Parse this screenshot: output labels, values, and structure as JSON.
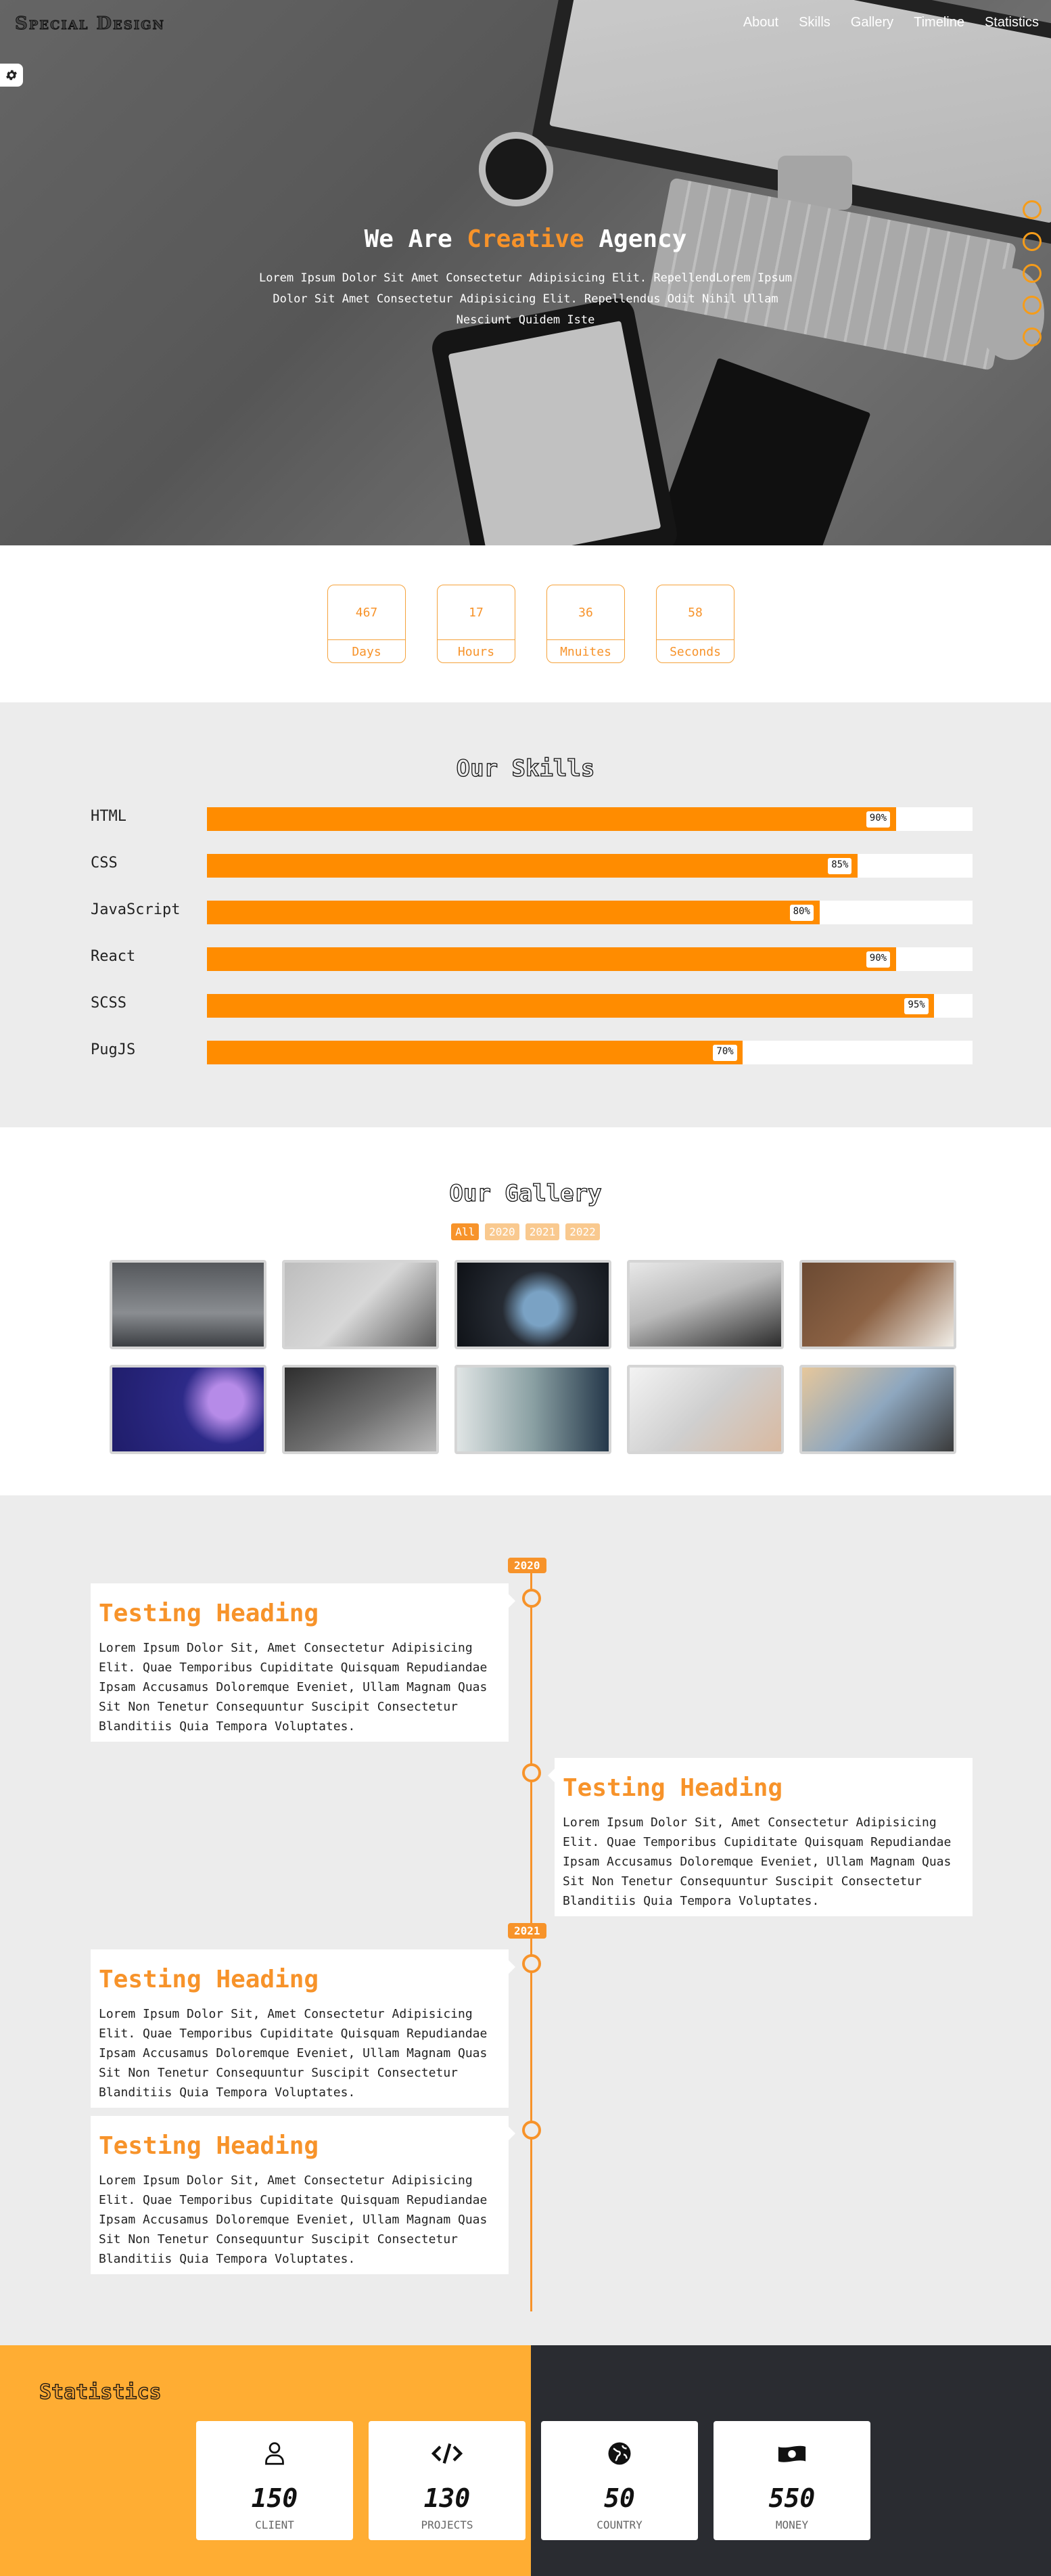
{
  "header": {
    "logo": "Special Design",
    "nav": [
      "About",
      "Skills",
      "Gallery",
      "Timeline",
      "Statistics"
    ]
  },
  "hero": {
    "title_prefix": "We Are ",
    "title_accent": "Creative",
    "title_suffix": " Agency",
    "text": "Lorem Ipsum Dolor Sit Amet Consectetur Adipisicing Elit. RepellendLorem Ipsum Dolor Sit Amet Consectetur Adipisicing Elit. Repellendus Odit Nihil Ullam Nesciunt Quidem Iste",
    "accent_color": "#f7932a"
  },
  "countdown": [
    {
      "value": "467",
      "unit": "Days"
    },
    {
      "value": "17",
      "unit": "Hours"
    },
    {
      "value": "36",
      "unit": "Mnuites"
    },
    {
      "value": "58",
      "unit": "Seconds"
    }
  ],
  "skills": {
    "title": "Our Skills",
    "items": [
      {
        "name": "HTML",
        "percent": 90,
        "label": "90%"
      },
      {
        "name": "CSS",
        "percent": 85,
        "label": "85%"
      },
      {
        "name": "JavaScript",
        "percent": 80,
        "label": "80%"
      },
      {
        "name": "React",
        "percent": 90,
        "label": "90%"
      },
      {
        "name": "SCSS",
        "percent": 95,
        "label": "95%"
      },
      {
        "name": "PugJS",
        "percent": 70,
        "label": "70%"
      }
    ],
    "fill_color": "#ff8c00"
  },
  "gallery": {
    "title": "Our Gallery",
    "filters": [
      "All",
      "2020",
      "2021",
      "2022"
    ],
    "active_filter": "All"
  },
  "timeline": {
    "years": [
      "2020",
      "2021"
    ],
    "entries": [
      {
        "heading": "Testing Heading",
        "text": "Lorem Ipsum Dolor Sit, Amet Consectetur Adipisicing Elit. Quae Temporibus Cupiditate Quisquam Repudiandae Ipsam Accusamus Doloremque Eveniet, Ullam Magnam Quas Sit Non Tenetur Consequuntur Suscipit Consectetur Blanditiis Quia Tempora Voluptates."
      },
      {
        "heading": "Testing Heading",
        "text": "Lorem Ipsum Dolor Sit, Amet Consectetur Adipisicing Elit. Quae Temporibus Cupiditate Quisquam Repudiandae Ipsam Accusamus Doloremque Eveniet, Ullam Magnam Quas Sit Non Tenetur Consequuntur Suscipit Consectetur Blanditiis Quia Tempora Voluptates."
      },
      {
        "heading": "Testing Heading",
        "text": "Lorem Ipsum Dolor Sit, Amet Consectetur Adipisicing Elit. Quae Temporibus Cupiditate Quisquam Repudiandae Ipsam Accusamus Doloremque Eveniet, Ullam Magnam Quas Sit Non Tenetur Consequuntur Suscipit Consectetur Blanditiis Quia Tempora Voluptates."
      },
      {
        "heading": "Testing Heading",
        "text": "Lorem Ipsum Dolor Sit, Amet Consectetur Adipisicing Elit. Quae Temporibus Cupiditate Quisquam Repudiandae Ipsam Accusamus Doloremque Eveniet, Ullam Magnam Quas Sit Non Tenetur Consequuntur Suscipit Consectetur Blanditiis Quia Tempora Voluptates."
      }
    ]
  },
  "statistics": {
    "title": "Statistics",
    "items": [
      {
        "icon": "user-icon",
        "value": "150",
        "label": "CLIENT"
      },
      {
        "icon": "code-icon",
        "value": "130",
        "label": "PROJECTS"
      },
      {
        "icon": "globe-icon",
        "value": "50",
        "label": "COUNTRY"
      },
      {
        "icon": "money-icon",
        "value": "550",
        "label": "MONEY"
      }
    ]
  }
}
